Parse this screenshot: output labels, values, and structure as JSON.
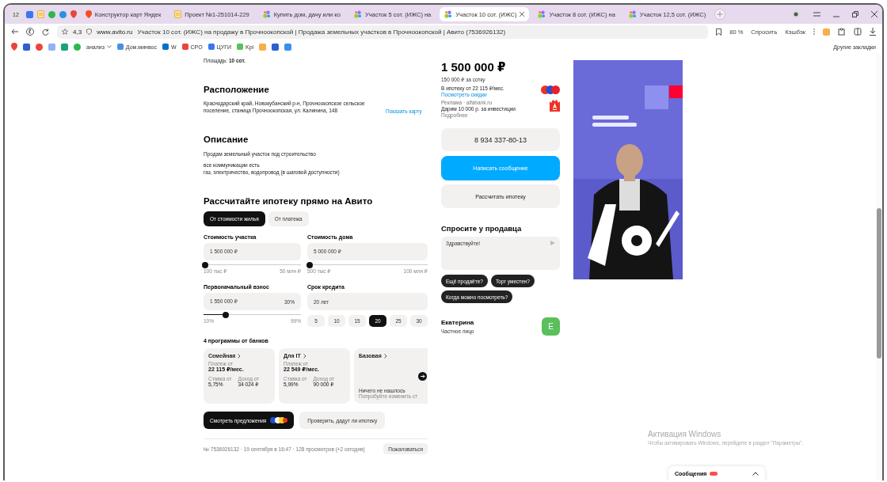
{
  "browser": {
    "tab_count": "12",
    "tabs": [
      {
        "label": "Конструктор карт Яндек",
        "kind": "maps",
        "selected": false
      },
      {
        "label": "Проект №1-251014-229",
        "kind": "doc",
        "selected": false
      },
      {
        "label": "Купить дом, дачу или ко",
        "kind": "avito",
        "selected": false
      },
      {
        "label": "Участок 5 сот. (ИЖС) на",
        "kind": "avito",
        "selected": false
      },
      {
        "label": "Участок 10 сот. (ИЖС)",
        "kind": "avito",
        "selected": true
      },
      {
        "label": "Участок 8 сот. (ИЖС) на",
        "kind": "avito",
        "selected": false
      },
      {
        "label": "Участок 12,5 сот. (ИЖС)",
        "kind": "avito",
        "selected": false
      }
    ],
    "rating": "4,3",
    "domain": "www.avito.ru",
    "page_title": "Участок 10 сот. (ИЖС) на продажу в Прочноокопской | Продажа земельных участков в Прочноокопской | Авито (7536926132)",
    "zoom": "80 %",
    "ask_button": "Спросить",
    "cashback_button": "Кэшбэк",
    "bookmarks": [
      {
        "label": "анализ",
        "kind": "folder"
      },
      {
        "label": "Дом.минвос",
        "kind": "link"
      },
      {
        "label": "W",
        "kind": "link"
      },
      {
        "label": "СРО",
        "kind": "link"
      },
      {
        "label": "ЦУГИ",
        "kind": "link"
      },
      {
        "label": "Kpi",
        "kind": "link"
      }
    ],
    "other_bookmarks": "Другие закладки"
  },
  "listing": {
    "area": "Площадь: **10 сот.**",
    "location_title": "Расположение",
    "address": "Краснодарский край, Новокубанский р-н, Прочноокопское сельское поселение, станица Прочноокопская, ул. Калинина, 148",
    "map_link": "Показать карту",
    "description_title": "Описание",
    "description": [
      "Продам земельный участок под строительство",
      "все коммуникации есть",
      "газ, электричество, водопровод (в шаговой доступности)"
    ]
  },
  "mortgage": {
    "title": "Рассчитайте ипотеку прямо на Авито",
    "modes": [
      {
        "label": "От стоимости жилья",
        "selected": true
      },
      {
        "label": "От платежа",
        "selected": false
      }
    ],
    "fields": [
      {
        "label": "Стоимость участка",
        "value": "1 500 000 ₽",
        "level": 0.02,
        "min": "100 тыс ₽",
        "max": "50 млн ₽"
      },
      {
        "label": "Стоимость дома",
        "value": "5 000 000 ₽",
        "level": 0.02,
        "min": "500 тыс ₽",
        "max": "100 млн ₽"
      },
      {
        "label": "Первоначальный взнос",
        "value": "1 550 000 ₽",
        "suffix": "30%",
        "level": 0.23,
        "min": "10%",
        "max": "99%"
      }
    ],
    "term": {
      "label": "Срок кредита",
      "value": "20 лет",
      "options": [
        {
          "label": "5",
          "selected": false
        },
        {
          "label": "10",
          "selected": false
        },
        {
          "label": "15",
          "selected": false
        },
        {
          "label": "20",
          "selected": true
        },
        {
          "label": "25",
          "selected": false
        },
        {
          "label": "30",
          "selected": false
        }
      ]
    },
    "programs_title": "4 программы от банков",
    "programs": [
      {
        "kind": "offer",
        "name": "Семейная",
        "payment_label": "Платеж от",
        "payment": "22 115 ₽/мес.",
        "rate_label": "Ставка от",
        "rate": "5,75%",
        "income_label": "Доход от",
        "income": "34 024 ₽"
      },
      {
        "kind": "offer",
        "name": "Для IT",
        "payment_label": "Платеж от",
        "payment": "22 549 ₽/мес.",
        "rate_label": "Ставка от",
        "rate": "5,99%",
        "income_label": "Доход от",
        "income": "90 000 ₽"
      },
      {
        "kind": "empty",
        "name": "Базовая",
        "message": "Ничего не нашлось",
        "hint": "Попробуйте изменить ст"
      }
    ],
    "offers_button": "Смотреть предложения",
    "check_button": "Проверить, дадут ли ипотеку"
  },
  "footer": {
    "info": "№ 7536926132 · 19 сентября в 16:47 · 128 просмотров (+2 сегодня)",
    "report_button": "Пожаловаться"
  },
  "sidebar": {
    "price": "1 500 000 ₽",
    "price_per_unit": "150 000 ₽ за сотку",
    "mortgage_line": "В ипотеку от 22 115 ₽/мес.",
    "mortgage_link": "Посмотреть скидки",
    "ad_label": "Реклама · alfabank.ru",
    "ad_text": "Дарим 10 000 р. за инвестиции",
    "ad_more": "Подробнее",
    "phone": "8 934 337-80-13",
    "message_button": "Написать сообщение",
    "calc_button": "Рассчитать ипотеку",
    "ask_title": "Спросите у продавца",
    "ask_value": "Здравствуйте!",
    "quick_questions": [
      "Ещё продаёте?",
      "Торг уместен?",
      "Когда можно посмотреть?"
    ],
    "seller_name": "Екатерина",
    "seller_type": "Частное лицо",
    "seller_initial": "Е"
  },
  "messages": {
    "label": "Сообщения"
  },
  "windows_notice": {
    "title": "Активация Windows",
    "text": "Чтобы активировать Windows, перейдите в раздел \"Параметры\"."
  }
}
